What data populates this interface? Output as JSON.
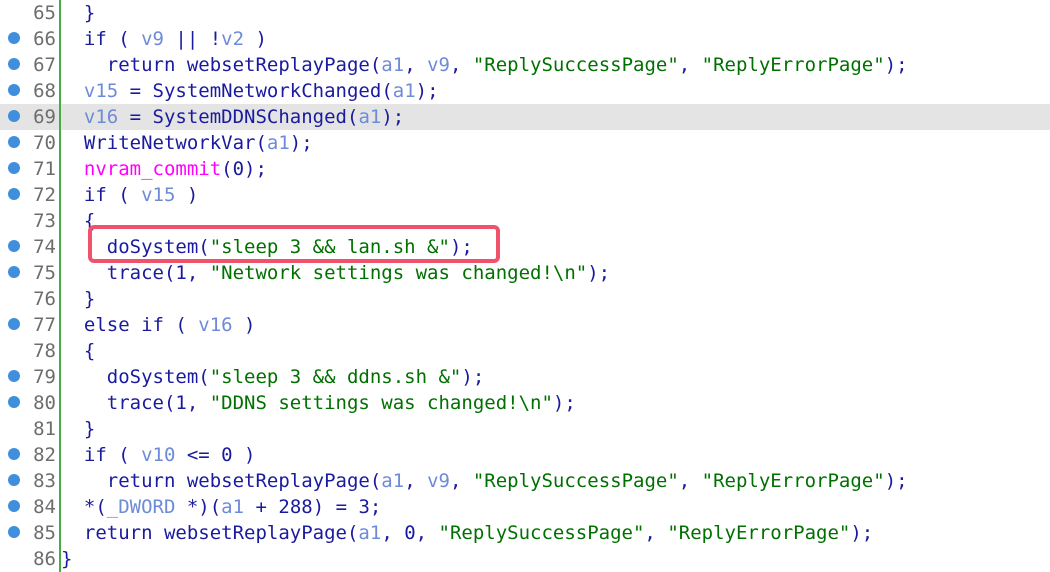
{
  "colors": {
    "breakpoint": "#3f8fdc",
    "gutter_line": "#49aa49",
    "highlight_box": "#f0526b",
    "current_line": "#e4e4e4",
    "string": "#007000",
    "identifier": "#1a1a9e",
    "variable": "#6d8bd8",
    "import": "#ff00ff"
  },
  "lines": [
    {
      "num": "65",
      "bp": false,
      "current": false,
      "tokens": [
        {
          "t": "  }",
          "c": "def"
        }
      ]
    },
    {
      "num": "66",
      "bp": true,
      "current": false,
      "tokens": [
        {
          "t": "  if ( ",
          "c": "kw"
        },
        {
          "t": "v9",
          "c": "var"
        },
        {
          "t": " || !",
          "c": "def"
        },
        {
          "t": "v2",
          "c": "var"
        },
        {
          "t": " )",
          "c": "def"
        }
      ]
    },
    {
      "num": "67",
      "bp": true,
      "current": false,
      "tokens": [
        {
          "t": "    return websetReplayPage(",
          "c": "def"
        },
        {
          "t": "a1",
          "c": "arg"
        },
        {
          "t": ", ",
          "c": "def"
        },
        {
          "t": "v9",
          "c": "var"
        },
        {
          "t": ", ",
          "c": "def"
        },
        {
          "t": "\"ReplySuccessPage\"",
          "c": "str"
        },
        {
          "t": ", ",
          "c": "def"
        },
        {
          "t": "\"ReplyErrorPage\"",
          "c": "str"
        },
        {
          "t": ");",
          "c": "def"
        }
      ]
    },
    {
      "num": "68",
      "bp": true,
      "current": false,
      "tokens": [
        {
          "t": "  ",
          "c": "def"
        },
        {
          "t": "v15",
          "c": "var"
        },
        {
          "t": " = SystemNetworkChanged(",
          "c": "def"
        },
        {
          "t": "a1",
          "c": "arg"
        },
        {
          "t": ");",
          "c": "def"
        }
      ]
    },
    {
      "num": "69",
      "bp": true,
      "current": true,
      "tokens": [
        {
          "t": "  ",
          "c": "def"
        },
        {
          "t": "v16",
          "c": "var"
        },
        {
          "t": " = SystemDDNSChanged(",
          "c": "def"
        },
        {
          "t": "a1",
          "c": "arg"
        },
        {
          "t": ");",
          "c": "def"
        }
      ]
    },
    {
      "num": "70",
      "bp": true,
      "current": false,
      "tokens": [
        {
          "t": "  WriteNetworkVar(",
          "c": "def"
        },
        {
          "t": "a1",
          "c": "arg"
        },
        {
          "t": ");",
          "c": "def"
        }
      ]
    },
    {
      "num": "71",
      "bp": true,
      "current": false,
      "tokens": [
        {
          "t": "  ",
          "c": "def"
        },
        {
          "t": "nvram_commit",
          "c": "imp"
        },
        {
          "t": "(0);",
          "c": "def"
        }
      ]
    },
    {
      "num": "72",
      "bp": true,
      "current": false,
      "tokens": [
        {
          "t": "  if ( ",
          "c": "kw"
        },
        {
          "t": "v15",
          "c": "var"
        },
        {
          "t": " )",
          "c": "def"
        }
      ]
    },
    {
      "num": "73",
      "bp": false,
      "current": false,
      "tokens": [
        {
          "t": "  {",
          "c": "def"
        }
      ]
    },
    {
      "num": "74",
      "bp": true,
      "current": false,
      "tokens": [
        {
          "t": "    doSystem(",
          "c": "def"
        },
        {
          "t": "\"sleep 3 && lan.sh &\"",
          "c": "str"
        },
        {
          "t": ");",
          "c": "def"
        }
      ]
    },
    {
      "num": "75",
      "bp": true,
      "current": false,
      "tokens": [
        {
          "t": "    trace(1, ",
          "c": "def"
        },
        {
          "t": "\"Network settings was changed!\\n\"",
          "c": "str"
        },
        {
          "t": ");",
          "c": "def"
        }
      ]
    },
    {
      "num": "76",
      "bp": false,
      "current": false,
      "tokens": [
        {
          "t": "  }",
          "c": "def"
        }
      ]
    },
    {
      "num": "77",
      "bp": true,
      "current": false,
      "tokens": [
        {
          "t": "  else if ( ",
          "c": "kw"
        },
        {
          "t": "v16",
          "c": "var"
        },
        {
          "t": " )",
          "c": "def"
        }
      ]
    },
    {
      "num": "78",
      "bp": false,
      "current": false,
      "tokens": [
        {
          "t": "  {",
          "c": "def"
        }
      ]
    },
    {
      "num": "79",
      "bp": true,
      "current": false,
      "tokens": [
        {
          "t": "    doSystem(",
          "c": "def"
        },
        {
          "t": "\"sleep 3 && ddns.sh &\"",
          "c": "str"
        },
        {
          "t": ");",
          "c": "def"
        }
      ]
    },
    {
      "num": "80",
      "bp": true,
      "current": false,
      "tokens": [
        {
          "t": "    trace(1, ",
          "c": "def"
        },
        {
          "t": "\"DDNS settings was changed!\\n\"",
          "c": "str"
        },
        {
          "t": ");",
          "c": "def"
        }
      ]
    },
    {
      "num": "81",
      "bp": false,
      "current": false,
      "tokens": [
        {
          "t": "  }",
          "c": "def"
        }
      ]
    },
    {
      "num": "82",
      "bp": true,
      "current": false,
      "tokens": [
        {
          "t": "  if ( ",
          "c": "kw"
        },
        {
          "t": "v10",
          "c": "var"
        },
        {
          "t": " <= 0 )",
          "c": "def"
        }
      ]
    },
    {
      "num": "83",
      "bp": true,
      "current": false,
      "tokens": [
        {
          "t": "    return websetReplayPage(",
          "c": "def"
        },
        {
          "t": "a1",
          "c": "arg"
        },
        {
          "t": ", ",
          "c": "def"
        },
        {
          "t": "v9",
          "c": "var"
        },
        {
          "t": ", ",
          "c": "def"
        },
        {
          "t": "\"ReplySuccessPage\"",
          "c": "str"
        },
        {
          "t": ", ",
          "c": "def"
        },
        {
          "t": "\"ReplyErrorPage\"",
          "c": "str"
        },
        {
          "t": ");",
          "c": "def"
        }
      ]
    },
    {
      "num": "84",
      "bp": true,
      "current": false,
      "tokens": [
        {
          "t": "  *(",
          "c": "def"
        },
        {
          "t": "_DWORD",
          "c": "type"
        },
        {
          "t": " *)(",
          "c": "def"
        },
        {
          "t": "a1",
          "c": "arg"
        },
        {
          "t": " + 288) = 3;",
          "c": "def"
        }
      ]
    },
    {
      "num": "85",
      "bp": true,
      "current": false,
      "tokens": [
        {
          "t": "  return websetReplayPage(",
          "c": "def"
        },
        {
          "t": "a1",
          "c": "arg"
        },
        {
          "t": ", 0, ",
          "c": "def"
        },
        {
          "t": "\"ReplySuccessPage\"",
          "c": "str"
        },
        {
          "t": ", ",
          "c": "def"
        },
        {
          "t": "\"ReplyErrorPage\"",
          "c": "str"
        },
        {
          "t": ");",
          "c": "def"
        }
      ]
    },
    {
      "num": "86",
      "bp": false,
      "current": false,
      "tokens": [
        {
          "t": "}",
          "c": "def"
        }
      ]
    }
  ]
}
